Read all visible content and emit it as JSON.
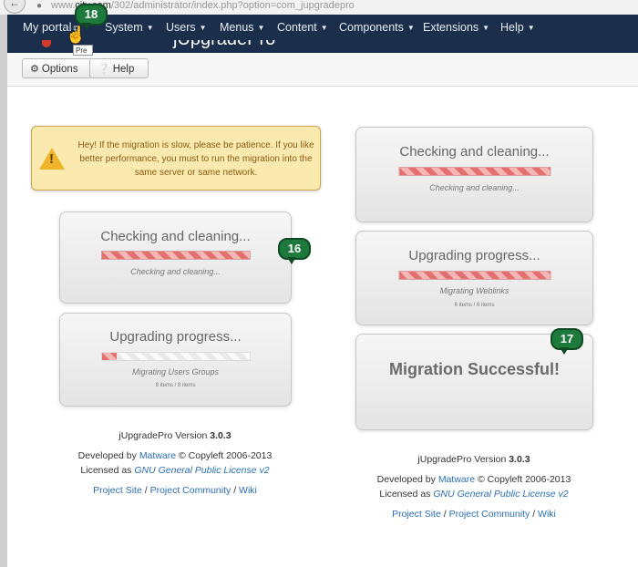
{
  "browser": {
    "url_prefix": "www.",
    "url_host": "city.com",
    "url_path": "/302/administrator/index.php?option=com_jupgradepro"
  },
  "nav": {
    "portal": "My portal",
    "menus": [
      {
        "label": "System"
      },
      {
        "label": "Users"
      },
      {
        "label": "Menus"
      },
      {
        "label": "Content"
      },
      {
        "label": "Components"
      },
      {
        "label": "Extensions"
      },
      {
        "label": "Help"
      }
    ],
    "tooltip": "Pre"
  },
  "header": {
    "title": "jUpgradePro"
  },
  "toolbar": {
    "options_label": "Options",
    "help_label": "Help"
  },
  "callouts": {
    "a": "18",
    "b": "16",
    "c": "17"
  },
  "warning": {
    "text": "Hey! If the migration is slow, please be patience. If you like better performance, you must to run the migration into the same server or same network."
  },
  "left": {
    "checking": {
      "title": "Checking and cleaning...",
      "status": "Checking and cleaning...",
      "progress": 1.0
    },
    "upgrading": {
      "title": "Upgrading progress...",
      "status": "Migrating Users Groups",
      "count": "8 items / 8 items",
      "progress": 0.1
    },
    "footer": {
      "version_label": "jUpgradePro Version",
      "version": "3.0.3",
      "developed_by": "Developed by",
      "author": "Matware",
      "copyleft": "© Copyleft 2006-2013",
      "licensed_as": "Licensed as",
      "license": "GNU General Public License v2",
      "project_site": "Project Site",
      "separator": "/",
      "project_community": "Project Community",
      "wiki": "Wiki"
    }
  },
  "right": {
    "checking": {
      "title": "Checking and cleaning...",
      "status": "Checking and cleaning...",
      "progress": 1.0
    },
    "upgrading": {
      "title": "Upgrading progress...",
      "status": "Migrating Weblinks",
      "count": "6 items / 6 items",
      "progress": 1.0
    },
    "success": "Migration Successful!",
    "footer": {
      "version_label": "jUpgradePro Version",
      "version": "3.0.3",
      "developed_by": "Developed by",
      "author": "Matware",
      "copyleft": "© Copyleft 2006-2013",
      "licensed_as": "Licensed as",
      "license": "GNU General Public License v2",
      "project_site": "Project Site",
      "separator": "/",
      "project_community": "Project Community",
      "wiki": "Wiki"
    }
  }
}
